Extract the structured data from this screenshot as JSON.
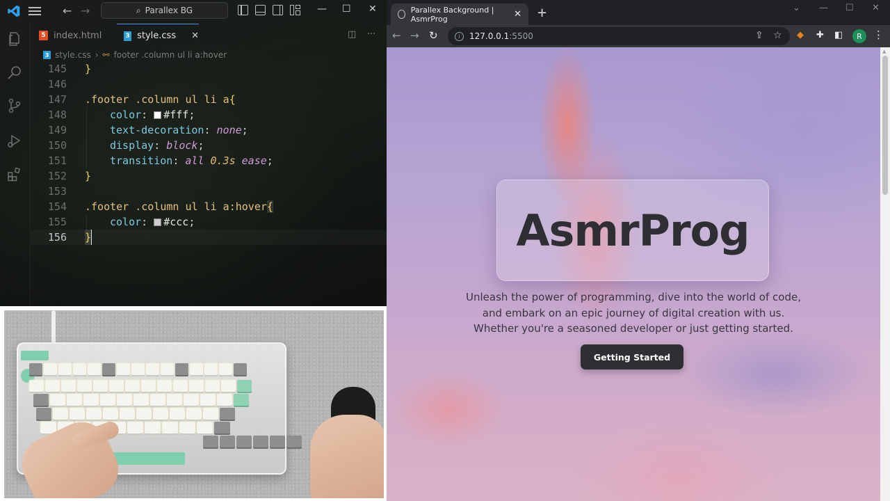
{
  "vscode": {
    "search_text": "Parallex BG",
    "tabs": [
      {
        "label": "index.html",
        "type": "html"
      },
      {
        "label": "style.css",
        "type": "css",
        "active": true
      }
    ],
    "breadcrumb": {
      "file": "style.css",
      "selector": "footer .column ul li a:hover"
    },
    "lines": [
      {
        "n": "145",
        "code": "}"
      },
      {
        "n": "146",
        "code": ""
      },
      {
        "n": "147",
        "code": ".footer .column ul li a{"
      },
      {
        "n": "148",
        "code": "color: #fff;"
      },
      {
        "n": "149",
        "code": "text-decoration: none;"
      },
      {
        "n": "150",
        "code": "display: block;"
      },
      {
        "n": "151",
        "code": "transition: all 0.3s ease;"
      },
      {
        "n": "152",
        "code": "}"
      },
      {
        "n": "153",
        "code": ""
      },
      {
        "n": "154",
        "code": ".footer .column ul li a:hover{"
      },
      {
        "n": "155",
        "code": "color: #ccc;"
      },
      {
        "n": "156",
        "code": "}"
      }
    ],
    "tokens": {
      "sel1": ".footer .column ul li a",
      "sel2": ".footer .column ul li a:hover",
      "color": "color",
      "text_decoration": "text-decoration",
      "display": "display",
      "transition": "transition",
      "hex_fff": "#fff",
      "hex_ccc": "#ccc",
      "none": "none",
      "block": "block",
      "all": "all",
      "dur": "0.3s",
      "ease": "ease"
    },
    "icons": [
      "vscode-logo-icon",
      "menu-icon",
      "back-arrow-icon",
      "forward-arrow-icon",
      "search-icon",
      "explorer-icon",
      "search-icon",
      "source-control-icon",
      "run-debug-icon",
      "extensions-icon",
      "split-editor-icon",
      "more-icon"
    ],
    "colors": {
      "accent": "#4a8fe0",
      "swatch_fff": "#ffffff",
      "swatch_ccc": "#cccccc"
    }
  },
  "chrome": {
    "tab_title": "Parallex Background | AsmrProg",
    "url_host": "127.0.0.1",
    "url_port": ":5500",
    "avatar_letter": "R",
    "icons": [
      "globe-icon",
      "close-icon",
      "new-tab-icon",
      "back-icon",
      "forward-icon",
      "reload-icon",
      "info-icon",
      "share-icon",
      "bookmark-star-icon",
      "metamask-icon",
      "extensions-puzzle-icon",
      "sidebar-icon",
      "kebab-menu-icon"
    ]
  },
  "page": {
    "title": "AsmrProg",
    "subtitle_lines": [
      "Unleash the power of programming, dive into the world of code,",
      "and embark on an epic journey of digital creation with us.",
      "Whether you're a seasoned developer or just getting started."
    ],
    "cta_label": "Getting Started"
  }
}
